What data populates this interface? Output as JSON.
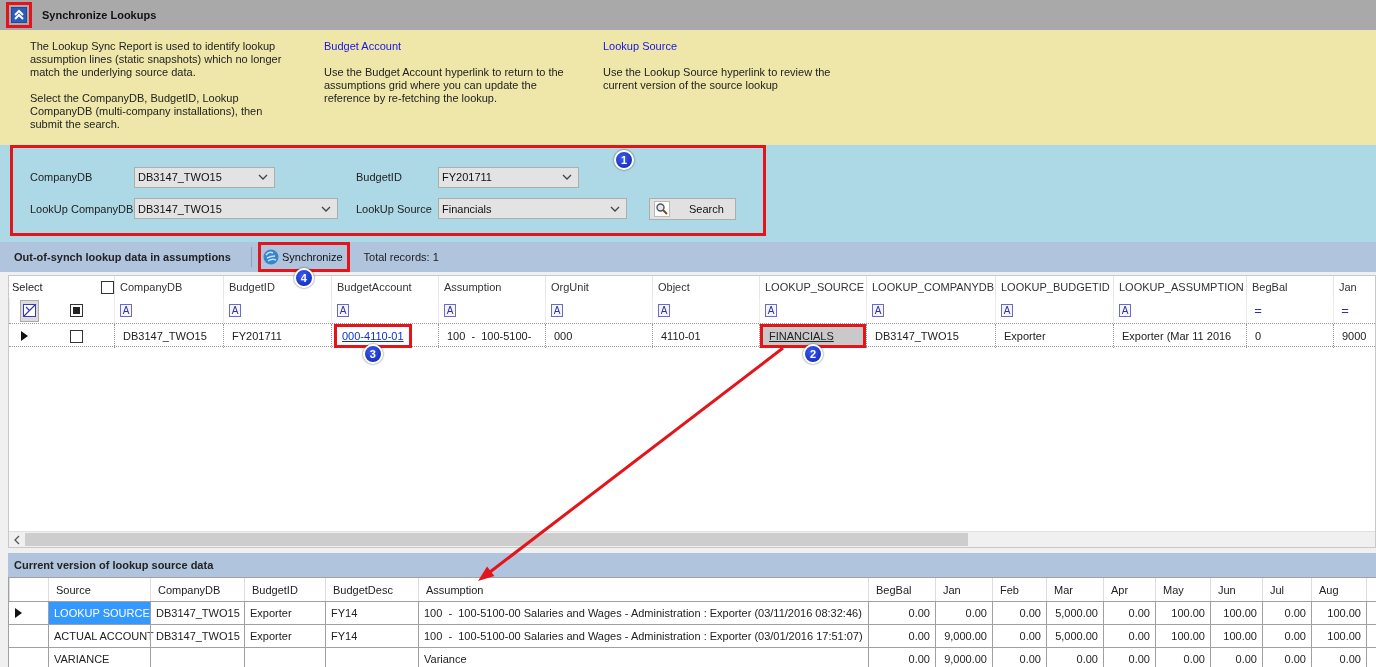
{
  "header": {
    "title": "Synchronize Lookups",
    "collapse_highlighted": true
  },
  "info": {
    "columns": [
      {
        "paragraphs": [
          "The Lookup Sync Report is used to identify lookup assumption lines (static snapshots) which no longer match the underlying source data.",
          "Select the CompanyDB, BudgetID, Lookup CompanyDB (multi-company installations), then submit the search."
        ]
      },
      {
        "heading": "Budget Account",
        "paragraphs": [
          "Use the Budget Account hyperlink to return to the assumptions grid where you can update the reference by re-fetching the lookup."
        ]
      },
      {
        "heading": "Lookup Source",
        "paragraphs": [
          "Use the Lookup Source hyperlink to review the current version of the source lookup"
        ]
      }
    ]
  },
  "filters": {
    "callout": "1",
    "rows": [
      {
        "fields": [
          {
            "label": "CompanyDB",
            "value": "DB3147_TWO15"
          },
          {
            "label": "BudgetID",
            "value": "FY201711"
          }
        ]
      },
      {
        "fields": [
          {
            "label": "LookUp CompanyDB",
            "value": "DB3147_TWO15"
          },
          {
            "label": "LookUp Source",
            "value": "Financials"
          }
        ]
      }
    ],
    "search_button": "Search"
  },
  "toolbar": {
    "title": "Out-of-synch lookup data in assumptions",
    "synchronize": {
      "label": "Synchronize",
      "callout": "4"
    },
    "total_records": "Total records: 1"
  },
  "assumptions_grid": {
    "select_header": "Select",
    "select_all_checked": false,
    "select_filter_indeterminate": true,
    "columns": [
      {
        "label": "CompanyDB",
        "filter": "A"
      },
      {
        "label": "BudgetID",
        "filter": "A"
      },
      {
        "label": "BudgetAccount",
        "filter": "A"
      },
      {
        "label": "Assumption",
        "filter": "A"
      },
      {
        "label": "OrgUnit",
        "filter": "A"
      },
      {
        "label": "Object",
        "filter": "A"
      },
      {
        "label": "LOOKUP_SOURCE",
        "filter": "A"
      },
      {
        "label": "LOOKUP_COMPANYDB",
        "filter": "A"
      },
      {
        "label": "LOOKUP_BUDGETID",
        "filter": "A"
      },
      {
        "label": "LOOKUP_ASSUMPTION",
        "filter": "A"
      },
      {
        "label": "BegBal",
        "filter": "="
      },
      {
        "label": "Jan",
        "filter": "="
      }
    ],
    "rows": [
      {
        "current": true,
        "checked": false,
        "cells": [
          {
            "text": "DB3147_TWO15",
            "kind": "text"
          },
          {
            "text": "FY201711",
            "kind": "text"
          },
          {
            "text": "000-4110-01",
            "kind": "link",
            "callout": "3"
          },
          {
            "text": "100  -  100-5100-",
            "kind": "text"
          },
          {
            "text": "000",
            "kind": "text"
          },
          {
            "text": "4110-01",
            "kind": "text"
          },
          {
            "text": "FINANCIALS",
            "kind": "link-button",
            "callout": "2"
          },
          {
            "text": "DB3147_TWO15",
            "kind": "text"
          },
          {
            "text": "Exporter",
            "kind": "text"
          },
          {
            "text": "Exporter (Mar 11 2016",
            "kind": "text"
          },
          {
            "text": "0",
            "kind": "text"
          },
          {
            "text": "9000",
            "kind": "text"
          }
        ]
      }
    ]
  },
  "source_grid": {
    "title": "Current version of lookup source data",
    "source_column": "Source",
    "columns": [
      "CompanyDB",
      "BudgetID",
      "BudgetDesc",
      "Assumption",
      "BegBal",
      "Jan",
      "Feb",
      "Mar",
      "Apr",
      "May",
      "Jun",
      "Jul",
      "Aug"
    ],
    "rows": [
      {
        "current": true,
        "source": {
          "text": "LOOKUP SOURCE",
          "selected": true
        },
        "cells": [
          "DB3147_TWO15",
          "Exporter",
          "FY14",
          "100  -  100-5100-00 Salaries and Wages - Administration : Exporter (03/11/2016 08:32:46)",
          "0.00",
          "0.00",
          "0.00",
          "5,000.00",
          "0.00",
          "100.00",
          "100.00",
          "0.00",
          "100.00"
        ]
      },
      {
        "current": false,
        "source": {
          "text": "ACTUAL ACCOUNT",
          "selected": false
        },
        "cells": [
          "DB3147_TWO15",
          "Exporter",
          "FY14",
          "100  -  100-5100-00 Salaries and Wages - Administration : Exporter (03/01/2016 17:51:07)",
          "0.00",
          "9,000.00",
          "0.00",
          "5,000.00",
          "0.00",
          "100.00",
          "100.00",
          "0.00",
          "100.00"
        ]
      },
      {
        "current": false,
        "source": {
          "text": "VARIANCE",
          "selected": false
        },
        "cells": [
          null,
          null,
          null,
          "Variance",
          "0.00",
          "9,000.00",
          "0.00",
          "0.00",
          "0.00",
          "0.00",
          "0.00",
          "0.00",
          "0.00"
        ]
      }
    ]
  }
}
